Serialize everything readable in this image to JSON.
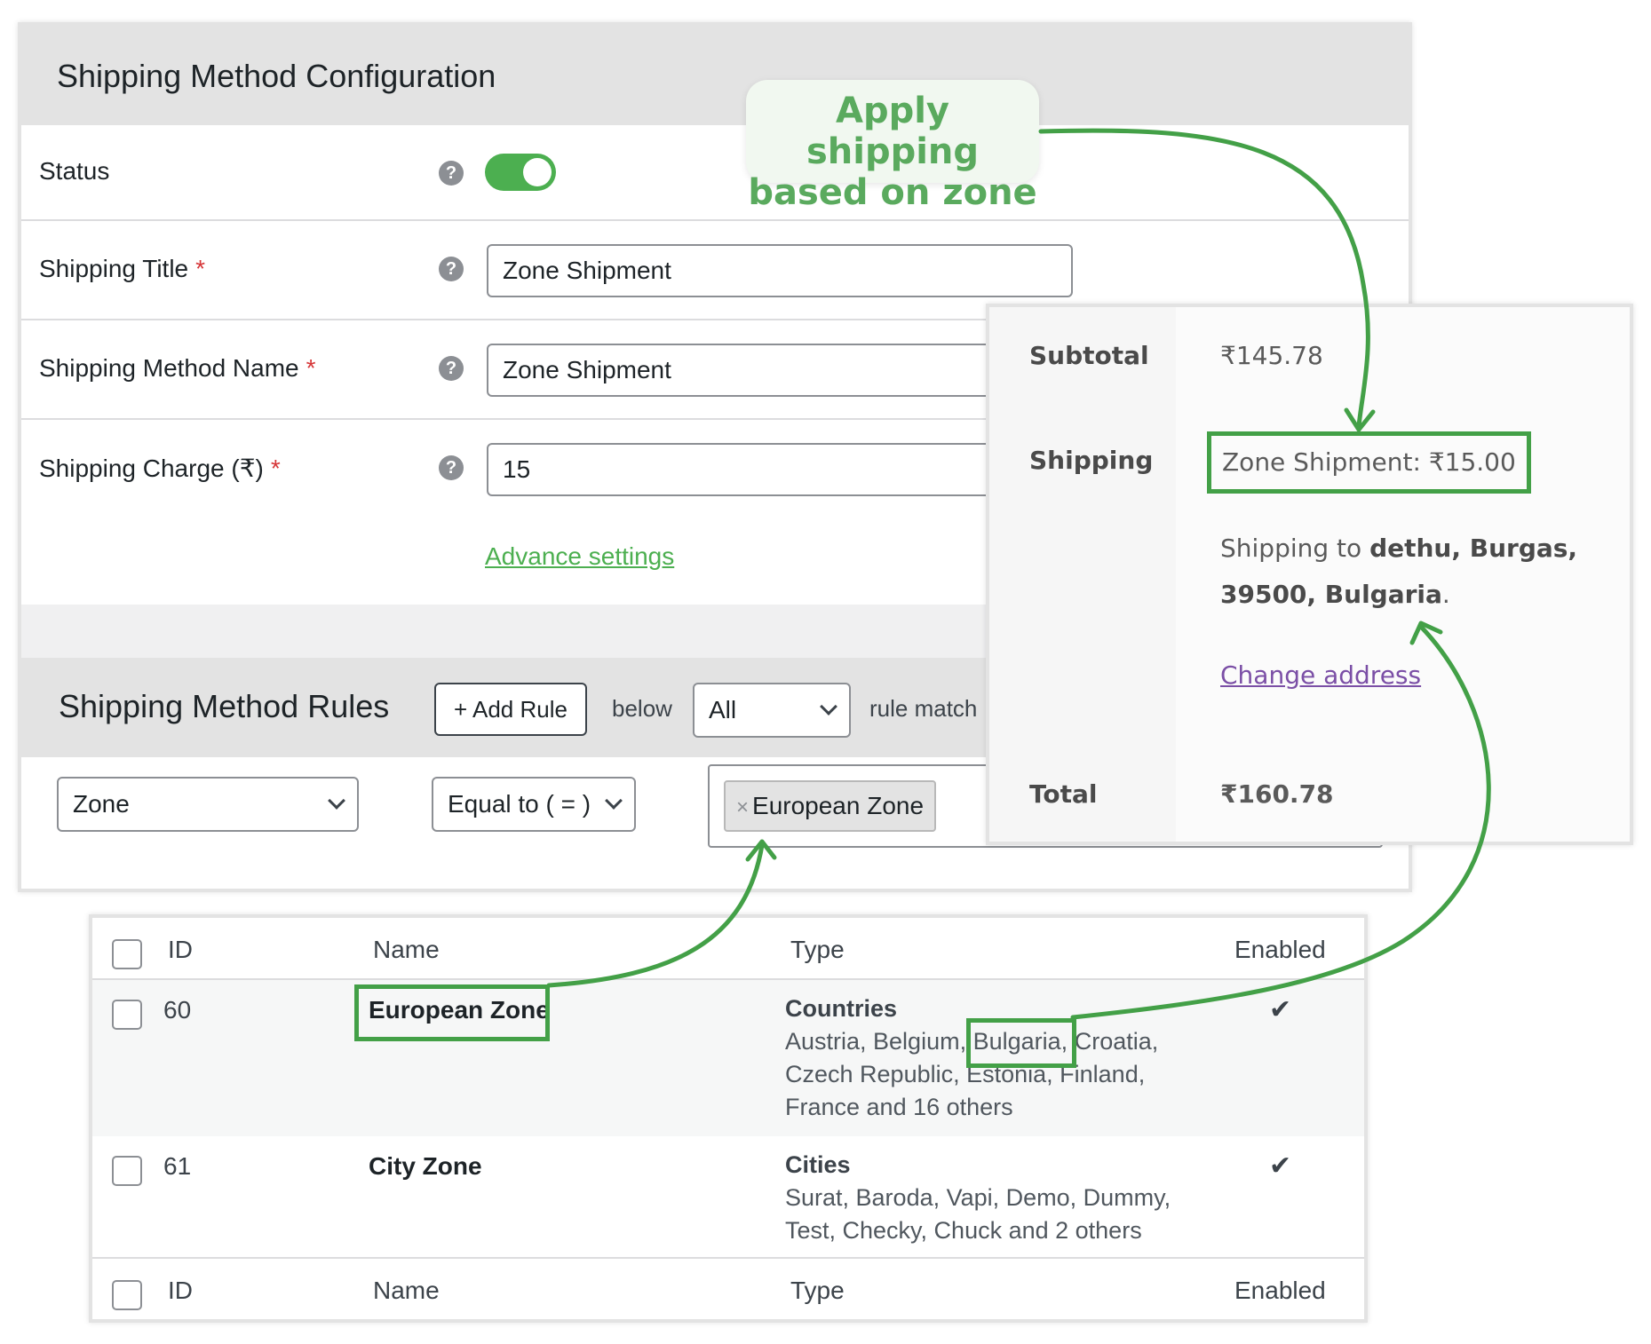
{
  "config": {
    "title": "Shipping Method Configuration",
    "status_label": "Status",
    "status_enabled": true,
    "shipping_title_label": "Shipping Title",
    "shipping_title_value": "Zone Shipment",
    "method_name_label": "Shipping Method Name",
    "method_name_value": "Zone Shipment",
    "charge_label": "Shipping Charge (₹)",
    "charge_value": "15",
    "required_mark": "*",
    "help_glyph": "?",
    "advance_settings": "Advance settings"
  },
  "rules": {
    "title": "Shipping Method Rules",
    "add_rule": "+ Add Rule",
    "below": "below",
    "match_select": "All",
    "rule_match": "rule match",
    "condition_field": "Zone",
    "operator": "Equal to ( = )",
    "tag_remove": "×",
    "selected_zone": "European Zone"
  },
  "totals": {
    "subtotal_label": "Subtotal",
    "subtotal_value": "₹145.78",
    "shipping_label": "Shipping",
    "shipping_method": "Zone Shipment: ₹15.00",
    "ship_to_prefix": "Shipping to",
    "ship_to_address": "dethu, Burgas, 39500, Bulgaria",
    "ship_to_suffix": ".",
    "change_address": "Change address",
    "total_label": "Total",
    "total_value": "₹160.78"
  },
  "zones": {
    "columns": {
      "id": "ID",
      "name": "Name",
      "type": "Type",
      "enabled": "Enabled"
    },
    "rows": [
      {
        "id": "60",
        "name": "European Zone",
        "type_head": "Countries",
        "type_pre": "Austria, Belgium,",
        "type_highlight": "Bulgaria,",
        "type_post": "Croatia,",
        "type_line2": "Czech Republic, Estonia, Finland,",
        "type_line3": "France and 16 others",
        "enabled": "✔"
      },
      {
        "id": "61",
        "name": "City Zone",
        "type_head": "Cities",
        "type_line1": "Surat, Baroda, Vapi, Demo, Dummy,",
        "type_line2": "Test, Checky, Chuck and 2 others",
        "enabled": "✔"
      }
    ]
  },
  "callout": {
    "line1": "Apply shipping",
    "line2": "based on zone"
  },
  "colors": {
    "accent_green": "#43a047",
    "toggle_on": "#4caf50",
    "link_purple": "#7b4fa6",
    "required_red": "#d63638"
  }
}
